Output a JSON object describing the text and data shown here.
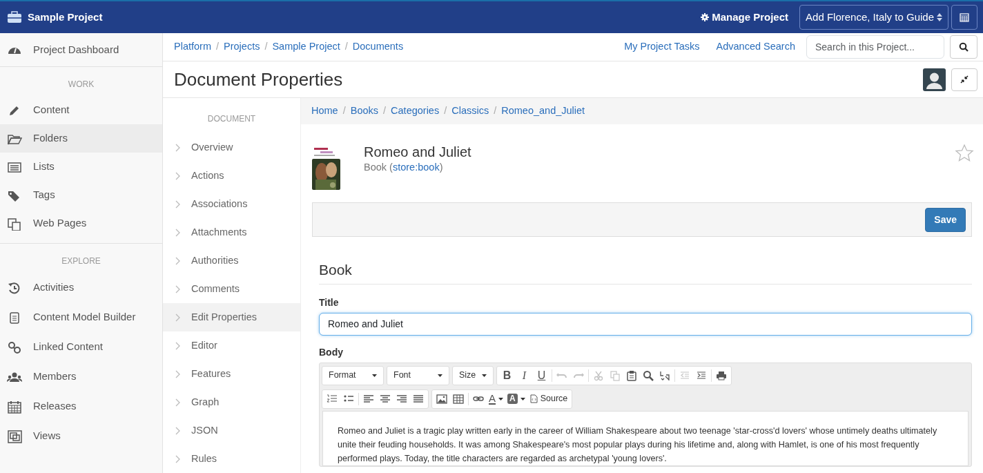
{
  "topbar": {
    "brand": "Sample Project",
    "manage": "Manage Project",
    "guide_select": "Add Florence, Italy to Guide"
  },
  "sidebar": {
    "top_item": {
      "label": "Project Dashboard",
      "selected": false
    },
    "sections": [
      {
        "header": "WORK",
        "items": [
          {
            "label": "Content",
            "selected": false
          },
          {
            "label": "Folders",
            "selected": true
          },
          {
            "label": "Lists",
            "selected": false
          },
          {
            "label": "Tags",
            "selected": false
          },
          {
            "label": "Web Pages",
            "selected": false
          }
        ]
      },
      {
        "header": "EXPLORE",
        "items": [
          {
            "label": "Activities",
            "selected": false
          },
          {
            "label": "Content Model Builder",
            "selected": false
          },
          {
            "label": "Linked Content",
            "selected": false
          },
          {
            "label": "Members",
            "selected": false
          },
          {
            "label": "Releases",
            "selected": false
          },
          {
            "label": "Views",
            "selected": false
          }
        ]
      }
    ]
  },
  "breadcrumb": [
    {
      "label": "Platform"
    },
    {
      "separator": "/",
      "label": "Projects"
    },
    {
      "separator": "/",
      "label": "Sample Project"
    },
    {
      "separator": "/",
      "label": "Documents"
    }
  ],
  "header_links": [
    "My Project Tasks",
    "Advanced Search"
  ],
  "search": {
    "placeholder": "Search in this Project..."
  },
  "page_title": "Document Properties",
  "doc_nav": {
    "header": "DOCUMENT",
    "items": [
      {
        "label": "Overview",
        "selected": false
      },
      {
        "label": "Actions",
        "selected": false
      },
      {
        "label": "Associations",
        "selected": false
      },
      {
        "label": "Attachments",
        "selected": false
      },
      {
        "label": "Authorities",
        "selected": false
      },
      {
        "label": "Comments",
        "selected": false
      },
      {
        "label": "Edit Properties",
        "selected": true
      },
      {
        "label": "Editor",
        "selected": false
      },
      {
        "label": "Features",
        "selected": false
      },
      {
        "label": "Graph",
        "selected": false
      },
      {
        "label": "JSON",
        "selected": false
      },
      {
        "label": "Rules",
        "selected": false
      }
    ]
  },
  "path": [
    {
      "label": "Home"
    },
    {
      "separator": "/",
      "label": "Books"
    },
    {
      "separator": "/",
      "label": "Categories"
    },
    {
      "separator": "/",
      "label": "Classics"
    },
    {
      "separator": "/",
      "label": "Romeo_and_Juliet"
    }
  ],
  "document": {
    "title": "Romeo and Juliet",
    "type_prefix": "Book (",
    "type_link": "store:book",
    "type_suffix": ")",
    "favorite": false
  },
  "save_button": "Save",
  "form": {
    "section": "Book",
    "title_label": "Title",
    "title_value": "Romeo and Juliet",
    "body_label": "Body",
    "toolbar_rows": [
      [
        {
          "items": [
            {
              "kind": "dropdown",
              "label": "Format"
            }
          ]
        },
        {
          "items": [
            {
              "kind": "dropdown",
              "label": "Font"
            }
          ]
        },
        {
          "items": [
            {
              "kind": "dropdown",
              "label": "Size"
            }
          ]
        },
        {
          "items": [
            {
              "kind": "bold",
              "label": "B"
            },
            {
              "kind": "italic",
              "label": "I"
            },
            {
              "kind": "underline",
              "label": "U"
            },
            {
              "kind": "separator"
            },
            {
              "kind": "icon",
              "disabled": true
            },
            {
              "kind": "icon",
              "disabled": true
            },
            {
              "kind": "separator"
            },
            {
              "kind": "icon",
              "disabled": true
            },
            {
              "kind": "icon",
              "disabled": true
            },
            {
              "kind": "icon",
              "disabled": false
            },
            {
              "kind": "icon",
              "disabled": false
            },
            {
              "kind": "icon",
              "disabled": false
            },
            {
              "kind": "separator"
            },
            {
              "kind": "icon",
              "disabled": true
            },
            {
              "kind": "icon",
              "disabled": false
            },
            {
              "kind": "separator"
            },
            {
              "kind": "icon",
              "disabled": false
            }
          ]
        }
      ],
      [
        {
          "items": [
            {
              "kind": "icon",
              "disabled": false
            },
            {
              "kind": "icon",
              "disabled": false
            },
            {
              "kind": "separator"
            },
            {
              "kind": "icon",
              "disabled": false
            },
            {
              "kind": "icon",
              "disabled": false
            },
            {
              "kind": "icon",
              "disabled": false
            },
            {
              "kind": "icon",
              "disabled": false
            }
          ]
        },
        {
          "items": [
            {
              "kind": "icon",
              "disabled": false
            },
            {
              "kind": "icon",
              "disabled": false
            },
            {
              "kind": "separator"
            },
            {
              "kind": "icon",
              "disabled": false
            },
            {
              "kind": "color",
              "label": "A"
            },
            {
              "kind": "fill",
              "label": "A"
            },
            {
              "kind": "source",
              "label": "Source"
            }
          ]
        }
      ]
    ],
    "body_text": "Romeo and Juliet is a tragic play written early in the career of William Shakespeare about two teenage 'star-cross'd lovers' whose untimely deaths ultimately unite their feuding households. It was among Shakespeare's most popular plays during his lifetime and, along with Hamlet, is one of his most frequently performed plays. Today, the title characters are regarded as archetypal 'young lovers'."
  }
}
